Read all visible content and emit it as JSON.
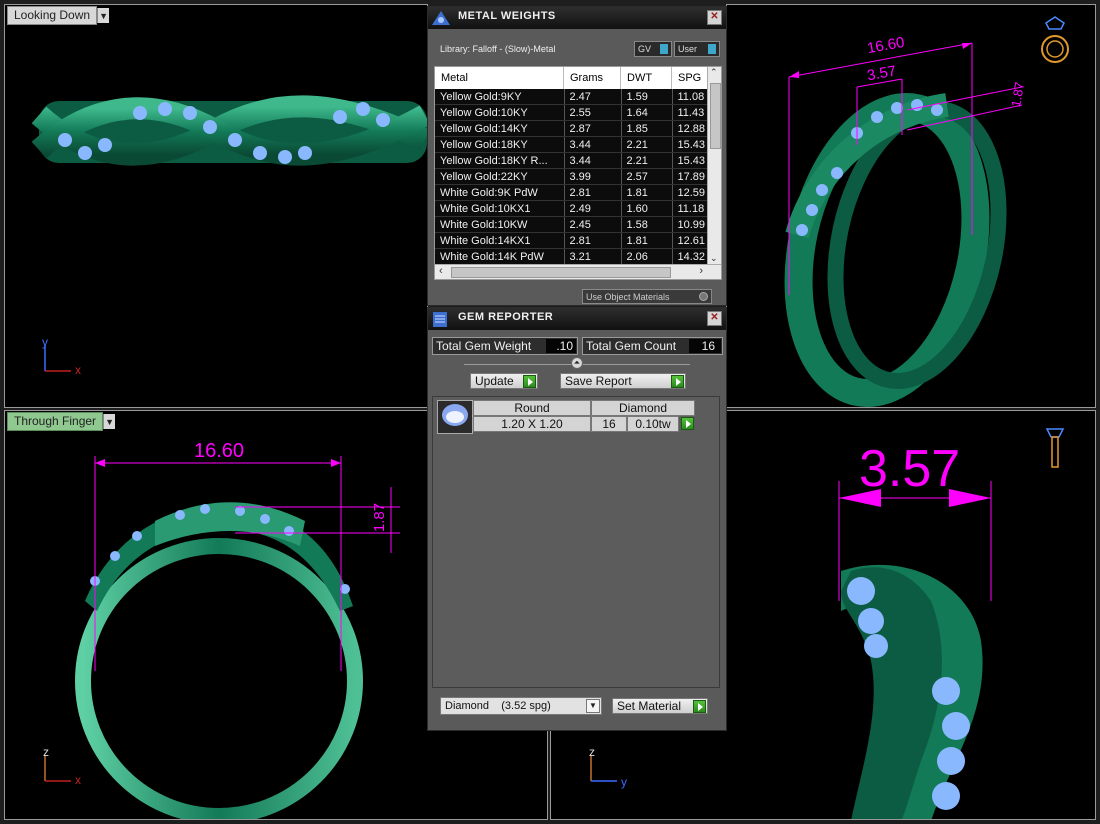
{
  "viewports": {
    "top_left": {
      "label": "Looking Down",
      "axis_v": "y",
      "axis_h": "x"
    },
    "bottom_left": {
      "label": "Through Finger",
      "axis_v": "z",
      "axis_h": "x"
    },
    "bottom_right": {
      "axis_v": "z",
      "axis_h": "y"
    }
  },
  "dimensions": {
    "top_right_width": "16.60",
    "top_right_gap": "3.57",
    "top_right_height": "1.87",
    "bottom_left_width": "16.60",
    "bottom_left_height": "1.87",
    "bottom_right_gap": "3.57"
  },
  "metal_weights": {
    "title": "METAL WEIGHTS",
    "library": "Library: Falloff - (Slow)-Metal",
    "toggle_gv": "GV",
    "toggle_user": "User",
    "columns": [
      "Metal",
      "Grams",
      "DWT",
      "SPG"
    ],
    "rows": [
      [
        "Yellow Gold:9KY",
        "2.47",
        "1.59",
        "11.08"
      ],
      [
        "Yellow Gold:10KY",
        "2.55",
        "1.64",
        "11.43"
      ],
      [
        "Yellow Gold:14KY",
        "2.87",
        "1.85",
        "12.88"
      ],
      [
        "Yellow Gold:18KY",
        "3.44",
        "2.21",
        "15.43"
      ],
      [
        "Yellow Gold:18KY R...",
        "3.44",
        "2.21",
        "15.43"
      ],
      [
        "Yellow Gold:22KY",
        "3.99",
        "2.57",
        "17.89"
      ],
      [
        "White Gold:9K PdW",
        "2.81",
        "1.81",
        "12.59"
      ],
      [
        "White Gold:10KX1",
        "2.49",
        "1.60",
        "11.18"
      ],
      [
        "White Gold:10KW",
        "2.45",
        "1.58",
        "10.99"
      ],
      [
        "White Gold:14KX1",
        "2.81",
        "1.81",
        "12.61"
      ],
      [
        "White Gold:14K PdW",
        "3.21",
        "2.06",
        "14.32"
      ]
    ],
    "use_object_materials": "Use Object Materials"
  },
  "gem_reporter": {
    "title": "GEM REPORTER",
    "total_weight_label": "Total Gem Weight",
    "total_weight_value": ".10",
    "total_count_label": "Total Gem Count",
    "total_count_value": "16",
    "update_label": "Update",
    "save_report_label": "Save Report",
    "gem": {
      "shape": "Round",
      "material": "Diamond",
      "size": "1.20 X 1.20",
      "count": "16",
      "weight": "0.10tw"
    },
    "material_select": "Diamond    (3.52 spg)",
    "set_material_label": "Set Material"
  },
  "colors": {
    "metal_green": "#137a58",
    "gem_blue": "#8ab8ff",
    "dimension_magenta": "#ff00ff",
    "viewport_bg": "#000000"
  }
}
